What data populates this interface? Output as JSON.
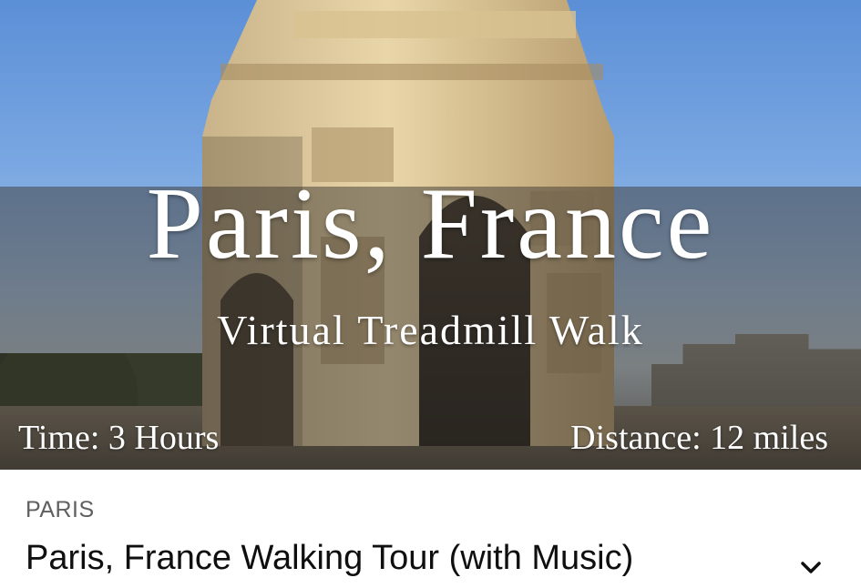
{
  "thumbnail": {
    "title": "Paris, France",
    "subtitle": "Virtual Treadmill Walk",
    "time": "Time: 3 Hours",
    "distance": "Distance: 12 miles"
  },
  "video": {
    "channel": "PARIS",
    "title": "Paris, France Walking Tour (with Music)",
    "expand_icon": "chevron-down-icon"
  },
  "colors": {
    "title_text": "#0f0f0f",
    "channel_text": "#606060",
    "overlay_text": "#ffffff"
  }
}
